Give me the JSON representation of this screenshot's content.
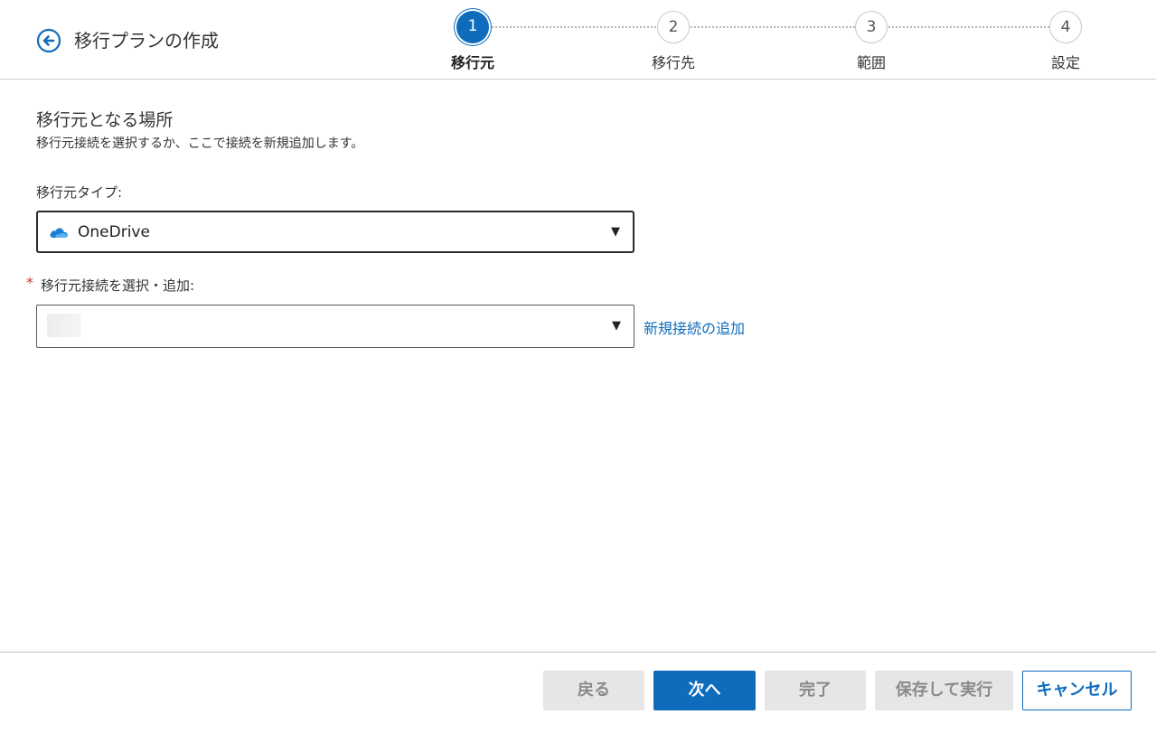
{
  "header": {
    "title": "移行プランの作成",
    "back_icon": "arrow-left-circle-icon"
  },
  "stepper": {
    "steps": [
      {
        "number": "1",
        "label": "移行元",
        "active": true
      },
      {
        "number": "2",
        "label": "移行先",
        "active": false
      },
      {
        "number": "3",
        "label": "範囲",
        "active": false
      },
      {
        "number": "4",
        "label": "設定",
        "active": false
      }
    ]
  },
  "main": {
    "section_title": "移行元となる場所",
    "section_subtitle": "移行元接続を選択するか、ここで接続を新規追加します。",
    "source_type": {
      "label": "移行元タイプ:",
      "value": "OneDrive",
      "icon": "onedrive-cloud-icon"
    },
    "connection": {
      "required_mark": "*",
      "label": "移行元接続を選択・追加:",
      "value": "",
      "add_link": "新規接続の追加"
    }
  },
  "footer": {
    "back": "戻る",
    "next": "次へ",
    "finish": "完了",
    "save_run": "保存して実行",
    "cancel": "キャンセル"
  },
  "colors": {
    "accent": "#0f6cbd",
    "required": "#d32f2f",
    "disabled_bg": "#e6e6e6"
  }
}
